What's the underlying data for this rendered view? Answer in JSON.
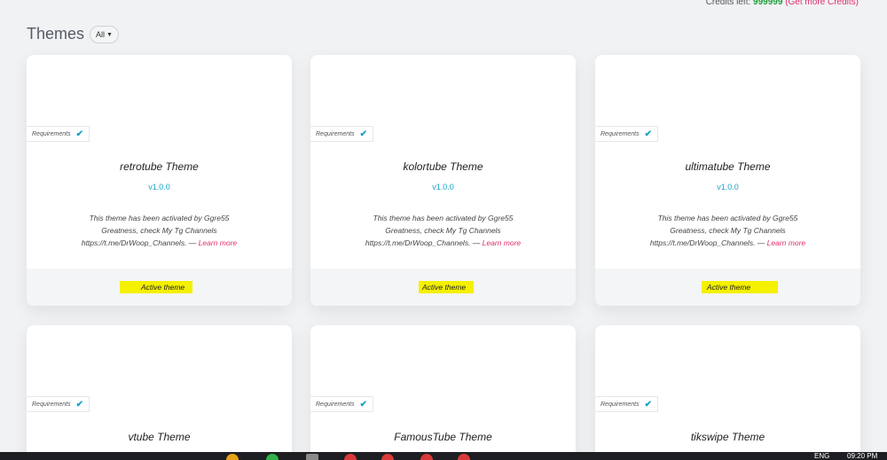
{
  "credits": {
    "label": "Credits left:",
    "value": "999999",
    "more": "(Get more Credits)"
  },
  "header": {
    "title": "Themes",
    "filter": "All"
  },
  "requirements_label": "Requirements",
  "cards": [
    {
      "title": "retrotube Theme",
      "version": "v1.0.0",
      "desc": "This theme has been activated by Ggre55 Greatness, check My Tg Channels https://t.me/DrWoop_Channels. —",
      "learn": "Learn more",
      "status": "Active theme"
    },
    {
      "title": "kolortube Theme",
      "version": "v1.0.0",
      "desc": "This theme has been activated by Ggre55 Greatness, check My Tg Channels https://t.me/DrWoop_Channels. —",
      "learn": "Learn more",
      "status": "Active theme"
    },
    {
      "title": "ultimatube Theme",
      "version": "v1.0.0",
      "desc": "This theme has been activated by Ggre55 Greatness, check My Tg Channels https://t.me/DrWoop_Channels. —",
      "learn": "Learn more",
      "status": "Active theme"
    },
    {
      "title": "vtube Theme"
    },
    {
      "title": "FamousTube Theme"
    },
    {
      "title": "tikswipe Theme"
    }
  ],
  "taskbar": {
    "lang": "ENG",
    "time": "09:20 PM"
  }
}
